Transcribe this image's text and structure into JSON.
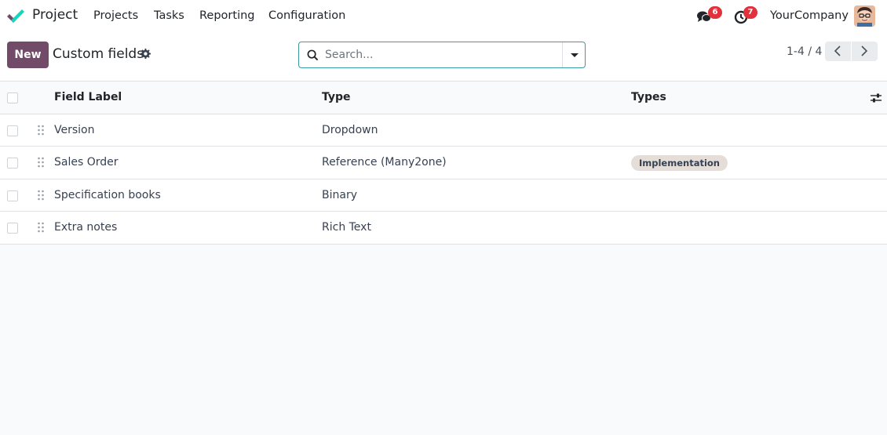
{
  "navbar": {
    "app_name": "Project",
    "menus": [
      "Projects",
      "Tasks",
      "Reporting",
      "Configuration"
    ],
    "messages_count": "6",
    "activities_count": "7",
    "company": "YourCompany",
    "brand_colors": {
      "teal": "#1ad3bb",
      "purple": "#714b67",
      "badge": "#e0313d"
    }
  },
  "control_panel": {
    "new_label": "New",
    "title": "Custom fields",
    "search_placeholder": "Search...",
    "pager_value": "1-4 / 4"
  },
  "table": {
    "columns": [
      "Field Label",
      "Type",
      "Types"
    ],
    "rows": [
      {
        "label": "Version",
        "type": "Dropdown",
        "types": ""
      },
      {
        "label": "Sales Order",
        "type": "Reference (Many2one)",
        "types": "Implementation"
      },
      {
        "label": "Specification books",
        "type": "Binary",
        "types": ""
      },
      {
        "label": "Extra notes",
        "type": "Rich Text",
        "types": ""
      }
    ]
  }
}
